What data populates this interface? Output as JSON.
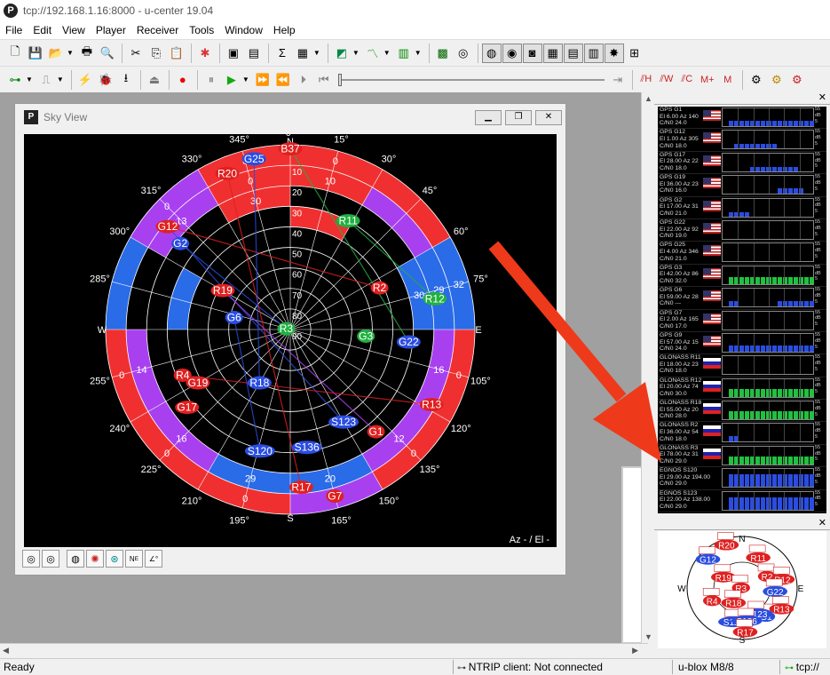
{
  "window": {
    "title": "tcp://192.168.1.16:8000 - u-center 19.04"
  },
  "menu": [
    "File",
    "Edit",
    "View",
    "Player",
    "Receiver",
    "Tools",
    "Window",
    "Help"
  ],
  "sky_view": {
    "title": "Sky View",
    "mode_label": "Az - / El -",
    "compass": [
      "N",
      "E",
      "S",
      "W"
    ],
    "azimuth_labels": [
      "0°",
      "15°",
      "30°",
      "45°",
      "60°",
      "75°",
      "105°",
      "120°",
      "135°",
      "150°",
      "165°",
      "195°",
      "210°",
      "225°",
      "240°",
      "255°",
      "285°",
      "300°",
      "315°",
      "330°",
      "345°"
    ],
    "elevation_labels": [
      "10",
      "20",
      "30",
      "40",
      "50",
      "60",
      "70",
      "80",
      "90"
    ],
    "sectors": [
      {
        "az_from": 0,
        "az_to": 30,
        "el_from": 0,
        "el_to": 10,
        "value": "0",
        "color": "#f03030"
      },
      {
        "az_from": 30,
        "az_to": 60,
        "el_from": 0,
        "el_to": 10,
        "value": "",
        "color": "#f03030"
      },
      {
        "az_from": 60,
        "az_to": 90,
        "el_from": 0,
        "el_to": 10,
        "value": "32",
        "color": "#2a6be8"
      },
      {
        "az_from": 90,
        "az_to": 120,
        "el_from": 0,
        "el_to": 10,
        "value": "0",
        "color": "#f03030"
      },
      {
        "az_from": 120,
        "az_to": 150,
        "el_from": 0,
        "el_to": 10,
        "value": "0",
        "color": "#f03030"
      },
      {
        "az_from": 150,
        "az_to": 180,
        "el_from": 0,
        "el_to": 10,
        "value": "14",
        "color": "#a840f0"
      },
      {
        "az_from": 180,
        "az_to": 210,
        "el_from": 0,
        "el_to": 10,
        "value": "0",
        "color": "#f03030"
      },
      {
        "az_from": 210,
        "az_to": 240,
        "el_from": 0,
        "el_to": 10,
        "value": "0",
        "color": "#f03030"
      },
      {
        "az_from": 240,
        "az_to": 270,
        "el_from": 0,
        "el_to": 10,
        "value": "0",
        "color": "#f03030"
      },
      {
        "az_from": 270,
        "az_to": 300,
        "el_from": 0,
        "el_to": 10,
        "value": "",
        "color": "#2a6be8"
      },
      {
        "az_from": 300,
        "az_to": 330,
        "el_from": 0,
        "el_to": 10,
        "value": "0",
        "color": "#a840f0"
      },
      {
        "az_from": 330,
        "az_to": 360,
        "el_from": 0,
        "el_to": 10,
        "value": "0",
        "color": "#f03030"
      },
      {
        "az_from": 0,
        "az_to": 30,
        "el_from": 10,
        "el_to": 20,
        "value": "10",
        "color": "#f03030"
      },
      {
        "az_from": 30,
        "az_to": 60,
        "el_from": 10,
        "el_to": 20,
        "value": "",
        "color": "#a840f0"
      },
      {
        "az_from": 60,
        "az_to": 90,
        "el_from": 10,
        "el_to": 20,
        "value": "29",
        "color": "#2a6be8"
      },
      {
        "az_from": 90,
        "az_to": 120,
        "el_from": 10,
        "el_to": 20,
        "value": "16",
        "color": "#a840f0"
      },
      {
        "az_from": 120,
        "az_to": 150,
        "el_from": 10,
        "el_to": 20,
        "value": "12",
        "color": "#a840f0"
      },
      {
        "az_from": 150,
        "az_to": 180,
        "el_from": 10,
        "el_to": 20,
        "value": "20",
        "color": "#2a6be8"
      },
      {
        "az_from": 180,
        "az_to": 210,
        "el_from": 10,
        "el_to": 20,
        "value": "29",
        "color": "#2a6be8"
      },
      {
        "az_from": 210,
        "az_to": 240,
        "el_from": 10,
        "el_to": 20,
        "value": "16",
        "color": "#a840f0"
      },
      {
        "az_from": 240,
        "az_to": 270,
        "el_from": 10,
        "el_to": 20,
        "value": "14",
        "color": "#a840f0"
      },
      {
        "az_from": 300,
        "az_to": 330,
        "el_from": 10,
        "el_to": 20,
        "value": "13",
        "color": "#a840f0"
      },
      {
        "az_from": 330,
        "az_to": 360,
        "el_from": 10,
        "el_to": 20,
        "value": "0",
        "color": "#f03030"
      },
      {
        "az_from": 60,
        "az_to": 90,
        "el_from": 20,
        "el_to": 30,
        "value": "30",
        "color": "#2a6be8"
      },
      {
        "az_from": 330,
        "az_to": 360,
        "el_from": 20,
        "el_to": 30,
        "value": "30",
        "color": "#f03030"
      },
      {
        "az_from": 0,
        "az_to": 30,
        "el_from": 30,
        "el_to": 40,
        "value": "",
        "color": "#f03030"
      },
      {
        "az_from": 270,
        "az_to": 300,
        "el_from": 30,
        "el_to": 40,
        "value": "",
        "color": "#2a6be8"
      }
    ],
    "satellites": [
      {
        "id": "B37",
        "az": 0,
        "el": 2,
        "color": "#e02020"
      },
      {
        "id": "G25",
        "az": 348,
        "el": 5,
        "color": "#2a4de0"
      },
      {
        "id": "R20",
        "az": 338,
        "el": 8,
        "color": "#e02020"
      },
      {
        "id": "R11",
        "az": 28,
        "el": 30,
        "color": "#20b040"
      },
      {
        "id": "G12",
        "az": 310,
        "el": 12,
        "color": "#e02020"
      },
      {
        "id": "G2",
        "az": 308,
        "el": 22,
        "color": "#2a4de0"
      },
      {
        "id": "R2",
        "az": 65,
        "el": 42,
        "color": "#e02020"
      },
      {
        "id": "R12",
        "az": 78,
        "el": 18,
        "color": "#20b040"
      },
      {
        "id": "R19",
        "az": 300,
        "el": 52,
        "color": "#e02020"
      },
      {
        "id": "G6",
        "az": 282,
        "el": 62,
        "color": "#2a4de0"
      },
      {
        "id": "R3",
        "az": 280,
        "el": 88,
        "color": "#20b040"
      },
      {
        "id": "G3",
        "az": 95,
        "el": 53,
        "color": "#20b040"
      },
      {
        "id": "G22",
        "az": 96,
        "el": 32,
        "color": "#2a4de0"
      },
      {
        "id": "R4",
        "az": 247,
        "el": 33,
        "color": "#e02020"
      },
      {
        "id": "G19",
        "az": 240,
        "el": 38,
        "color": "#e02020"
      },
      {
        "id": "R18",
        "az": 210,
        "el": 60,
        "color": "#2a4de0"
      },
      {
        "id": "G17",
        "az": 233,
        "el": 27,
        "color": "#e02020"
      },
      {
        "id": "R13",
        "az": 118,
        "el": 12,
        "color": "#e02020"
      },
      {
        "id": "S123",
        "az": 150,
        "el": 38,
        "color": "#2a4de0"
      },
      {
        "id": "G1",
        "az": 140,
        "el": 25,
        "color": "#e02020"
      },
      {
        "id": "S120",
        "az": 194,
        "el": 29,
        "color": "#2a4de0"
      },
      {
        "id": "S136",
        "az": 172,
        "el": 32,
        "color": "#2a4de0"
      },
      {
        "id": "R17",
        "az": 176,
        "el": 13,
        "color": "#e02020"
      },
      {
        "id": "G7",
        "az": 165,
        "el": 6,
        "color": "#e02020"
      }
    ]
  },
  "signal_panel": {
    "scale_labels": [
      "55",
      "dB",
      "5"
    ],
    "rows": [
      {
        "name": "GPS G1",
        "line2": "El 6.00 Az 140",
        "line3": "C/N0 24.0",
        "flag": "us",
        "levels": [
          0,
          0.3,
          0.3,
          0.3,
          0.3,
          0.3,
          0.3,
          0.3,
          0.3,
          0.3,
          0.3,
          0.3,
          0.3,
          0.3,
          0.3,
          0.3,
          0.3
        ],
        "color": "#2a4de0"
      },
      {
        "name": "GPS G12",
        "line2": "El 1.00 Az 305",
        "line3": "C/N0 18.0",
        "flag": "us",
        "levels": [
          0,
          0,
          0.25,
          0.25,
          0.25,
          0.25,
          0.25,
          0.25,
          0.25,
          0.25,
          0,
          0,
          0,
          0,
          0,
          0,
          0
        ],
        "color": "#2a4de0"
      },
      {
        "name": "GPS G17",
        "line2": "El 28.00 Az 22",
        "line3": "C/N0 18.0",
        "flag": "us",
        "levels": [
          0,
          0,
          0,
          0,
          0,
          0.25,
          0.25,
          0.25,
          0.25,
          0.25,
          0.25,
          0.25,
          0.25,
          0.25,
          0,
          0,
          0
        ],
        "color": "#2a4de0"
      },
      {
        "name": "GPS G19",
        "line2": "El 36.00 Az 23",
        "line3": "C/N0 16.0",
        "flag": "us",
        "levels": [
          0,
          0,
          0,
          0,
          0,
          0,
          0,
          0,
          0,
          0,
          0.3,
          0.3,
          0.3,
          0.3,
          0.3,
          0,
          0
        ],
        "color": "#2a4de0"
      },
      {
        "name": "GPS G2",
        "line2": "El 17.00 Az 31",
        "line3": "C/N0 21.0",
        "flag": "us",
        "levels": [
          0,
          0.25,
          0.25,
          0.25,
          0.25,
          0,
          0,
          0,
          0,
          0,
          0,
          0,
          0,
          0,
          0,
          0,
          0
        ],
        "color": "#2a4de0"
      },
      {
        "name": "GPS G22",
        "line2": "El 22.00 Az 92",
        "line3": "C/N0 19.0",
        "flag": "us",
        "levels": [
          0,
          0,
          0,
          0,
          0,
          0,
          0,
          0,
          0,
          0,
          0,
          0,
          0,
          0,
          0,
          0,
          0
        ],
        "color": "#2a4de0"
      },
      {
        "name": "GPS G25",
        "line2": "El 4.00 Az 346",
        "line3": "C/N0 21.0",
        "flag": "us",
        "levels": [
          0,
          0,
          0,
          0,
          0,
          0,
          0,
          0,
          0,
          0,
          0,
          0,
          0,
          0,
          0,
          0,
          0
        ],
        "color": "#2a4de0"
      },
      {
        "name": "GPS G3",
        "line2": "El 42.00 Az 86",
        "line3": "C/N0 32.0",
        "flag": "us",
        "levels": [
          0,
          0.4,
          0.4,
          0.4,
          0.4,
          0.4,
          0.4,
          0.4,
          0.4,
          0.4,
          0.4,
          0.4,
          0.4,
          0.4,
          0.4,
          0.4,
          0.4
        ],
        "color": "#22c040"
      },
      {
        "name": "GPS G6",
        "line2": "El 59.00 Az 28",
        "line3": "C/N0 ---",
        "flag": "us",
        "levels": [
          0,
          0.3,
          0.3,
          0,
          0,
          0,
          0,
          0,
          0,
          0,
          0.3,
          0.3,
          0.3,
          0.3,
          0.3,
          0.3,
          0.3
        ],
        "color": "#2a4de0"
      },
      {
        "name": "GPS G7",
        "line2": "El 2.00 Az 165",
        "line3": "C/N0 17.0",
        "flag": "us",
        "levels": [
          0,
          0,
          0,
          0,
          0,
          0,
          0,
          0,
          0,
          0,
          0,
          0,
          0,
          0,
          0,
          0,
          0
        ],
        "color": "#2a4de0"
      },
      {
        "name": "GPS G9",
        "line2": "El 57.00 Az 15",
        "line3": "C/N0 24.0",
        "flag": "us",
        "levels": [
          0,
          0.35,
          0.35,
          0.35,
          0.35,
          0.35,
          0.35,
          0.35,
          0.35,
          0.35,
          0.35,
          0.35,
          0.35,
          0.35,
          0.35,
          0.35,
          0.35
        ],
        "color": "#2a4de0"
      },
      {
        "name": "GLONASS R11",
        "line2": "El 18.00 Az 23",
        "line3": "C/N0 18.0",
        "flag": "ru",
        "levels": [
          0,
          0,
          0,
          0,
          0,
          0,
          0,
          0,
          0,
          0,
          0,
          0,
          0,
          0,
          0,
          0,
          0
        ],
        "color": "#2a4de0"
      },
      {
        "name": "GLONASS R12",
        "line2": "El 20.00 Az 74",
        "line3": "C/N0 30.0",
        "flag": "ru",
        "levels": [
          0,
          0.45,
          0.45,
          0.45,
          0.45,
          0.45,
          0.45,
          0.45,
          0.45,
          0.45,
          0.45,
          0.45,
          0.45,
          0.45,
          0.45,
          0.45,
          0.45
        ],
        "color": "#22c040"
      },
      {
        "name": "GLONASS R18",
        "line2": "El 55.00 Az 20",
        "line3": "C/N0 28.0",
        "flag": "ru",
        "levels": [
          0,
          0.45,
          0.45,
          0.45,
          0.45,
          0.45,
          0.45,
          0.45,
          0.45,
          0.45,
          0.45,
          0.45,
          0.45,
          0.45,
          0.45,
          0.45,
          0.45
        ],
        "color": "#22c040"
      },
      {
        "name": "GLONASS R2",
        "line2": "El 36.00 Az 54",
        "line3": "C/N0 18.0",
        "flag": "ru",
        "levels": [
          0,
          0.3,
          0.3,
          0,
          0,
          0,
          0,
          0,
          0,
          0,
          0,
          0,
          0,
          0,
          0,
          0,
          0
        ],
        "color": "#2a4de0"
      },
      {
        "name": "GLONASS R3",
        "line2": "El 78.00 Az 31",
        "line3": "C/N0 29.0",
        "flag": "ru",
        "levels": [
          0,
          0.45,
          0.45,
          0.45,
          0.45,
          0.45,
          0.45,
          0.45,
          0.45,
          0.45,
          0.45,
          0.45,
          0.45,
          0.45,
          0.45,
          0.45,
          0.45
        ],
        "color": "#22c040"
      },
      {
        "name": "EGNOS S120",
        "line2": "El 29.00 Az 194.00",
        "line3": "C/N0 29.0",
        "flag": "none",
        "levels": [
          0,
          0.7,
          0.7,
          0.7,
          0.7,
          0.7,
          0.7,
          0.7,
          0.7,
          0.7,
          0.7,
          0.7,
          0.7,
          0.7,
          0.7,
          0.7,
          0.7
        ],
        "color": "#2a4de0"
      },
      {
        "name": "EGNOS S123",
        "line2": "El 22.00 Az 138.00",
        "line3": "C/N0 29.0",
        "flag": "none",
        "levels": [
          0,
          0.7,
          0.7,
          0.7,
          0.7,
          0.7,
          0.7,
          0.7,
          0.7,
          0.7,
          0.7,
          0.7,
          0.7,
          0.7,
          0.7,
          0.7,
          0.7
        ],
        "color": "#2a4de0"
      }
    ]
  },
  "mini_sky": {
    "compass": [
      "N",
      "E",
      "S",
      "W"
    ],
    "labels": [
      {
        "id": "R20",
        "az": 340,
        "el": 10
      },
      {
        "id": "R11",
        "az": 28,
        "el": 30
      },
      {
        "id": "G12",
        "az": 310,
        "el": 12
      },
      {
        "id": "R19",
        "az": 300,
        "el": 52
      },
      {
        "id": "R2",
        "az": 65,
        "el": 42
      },
      {
        "id": "R12",
        "az": 78,
        "el": 18
      },
      {
        "id": "R3",
        "az": 280,
        "el": 88
      },
      {
        "id": "G22",
        "az": 96,
        "el": 32
      },
      {
        "id": "R4",
        "az": 247,
        "el": 33
      },
      {
        "id": "R18",
        "az": 210,
        "el": 60
      },
      {
        "id": "G1",
        "az": 140,
        "el": 25
      },
      {
        "id": "R13",
        "az": 118,
        "el": 12
      },
      {
        "id": "S123",
        "az": 150,
        "el": 38
      },
      {
        "id": "S120",
        "az": 194,
        "el": 29
      },
      {
        "id": "S136",
        "az": 172,
        "el": 32
      },
      {
        "id": "R17",
        "az": 176,
        "el": 13
      }
    ]
  },
  "status": {
    "ready": "Ready",
    "ntrip": "NTRIP client: Not connected",
    "receiver": "u-blox M8/8",
    "connection": "tcp://"
  },
  "colors": {
    "annotation_arrow": "#ee3a1a"
  }
}
